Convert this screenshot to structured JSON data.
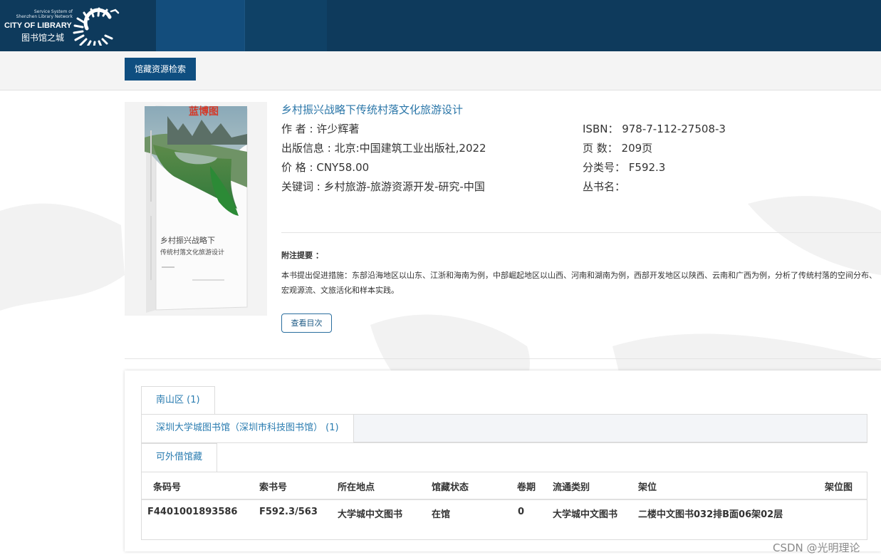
{
  "header": {
    "network_line1": "Service System of",
    "network_line2": "Shenzhen Library Network",
    "brand": "CITY OF LIBRARY",
    "brand_cn": "图书馆之城"
  },
  "nav": {
    "search_button": "馆藏资源检索"
  },
  "book": {
    "title": "乡村振兴战略下传统村落文化旅游设计",
    "cover_badge": "蓝博图",
    "cover_title_line1": "乡村振兴战略下",
    "cover_title_line2": "传统村落文化旅游设计",
    "author": "作 者 : 许少辉著",
    "publication": "出版信息 : 北京:中国建筑工业出版社,2022",
    "price": "价 格 : CNY58.00",
    "keywords": "关键词 : 乡村旅游-旅游资源开发-研究-中国",
    "isbn": "ISBN： 978-7-112-27508-3",
    "pages": "页 数： 209页",
    "classification": "分类号： F592.3",
    "series": "丛书名：",
    "note_label": "附注提要 ：",
    "note_text": "本书提出促进措施：东部沿海地区以山东、江浙和海南为例，中部崛起地区以山西、河南和湖南为例，西部开发地区以陕西、云南和广西为例，分析了传统村落的空间分布、宏观源流、文旅活化和样本实践。",
    "toc_button": "查看目次"
  },
  "holdings": {
    "tab_region": "南山区 (1)",
    "tab_library": "深圳大学城图书馆（深圳市科技图书馆） (1)",
    "tab_loanable": "可外借馆藏",
    "columns": [
      "条码号",
      "索书号",
      "所在地点",
      "馆藏状态",
      "卷期",
      "流通类别",
      "架位",
      "架位图"
    ],
    "rows": [
      [
        "F4401001893586",
        "F592.3/563",
        "大学城中文图书",
        "在馆",
        "0",
        "大学城中文图书",
        "二楼中文图书032排B面06架02层",
        ""
      ]
    ]
  },
  "watermark": "CSDN @光明理论",
  "colors": {
    "header": "#0e3a5c",
    "accent": "#0f4e80",
    "link": "#2a76a8"
  }
}
